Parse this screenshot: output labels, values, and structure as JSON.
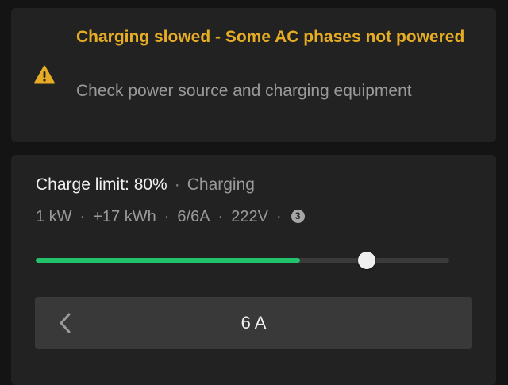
{
  "alert": {
    "title": "Charging slowed - Some AC phases not powered",
    "message": "Check power source and charging equipment",
    "icon": "warning-icon",
    "color": "#e6ac24"
  },
  "charging": {
    "limit_label": "Charge limit: 80%",
    "separator": "·",
    "state": "Charging",
    "stats": {
      "power": "1 kW",
      "energy_added": "+17 kWh",
      "current": "6/6A",
      "voltage": "222V",
      "phases_badge": "3"
    },
    "charge_level_percent": 64,
    "limit_percent": 80,
    "accent_color": "#22c36b"
  },
  "amp_control": {
    "value": "6 A",
    "decrease_icon": "chevron-left-icon"
  }
}
